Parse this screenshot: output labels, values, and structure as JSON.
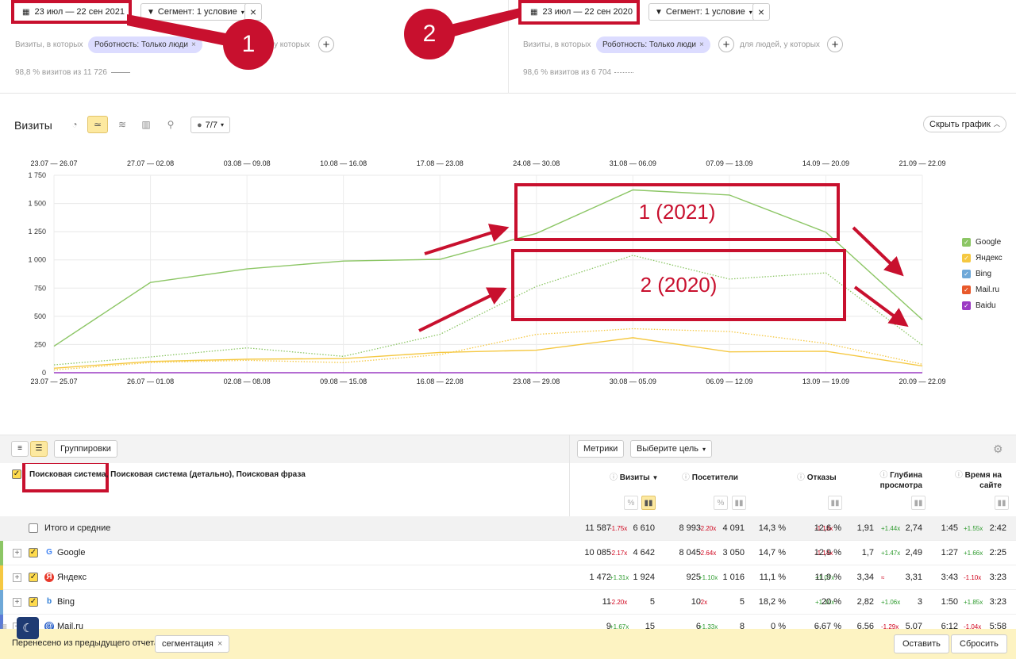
{
  "left_panel": {
    "date_range": "23 июл — 22 сен 2021",
    "segment_label": "Сегмент: 1 условие",
    "visits_where": "Визиты, в которых",
    "chip": "Роботность: Только люди",
    "people_where": "у которых",
    "stat": "98,8 % визитов из 11 726"
  },
  "right_panel": {
    "date_range": "23 июл — 22 сен 2020",
    "segment_label": "Сегмент: 1 условие",
    "visits_where": "Визиты, в которых",
    "chip": "Роботность: Только люди",
    "people_where": "для людей, у которых",
    "stat": "98,6 % визитов из 6 704"
  },
  "annotations": {
    "circle1": "1",
    "circle2": "2",
    "box_2021": "1 (2021)",
    "box_2020": "2 (2020)"
  },
  "chart_toolbar": {
    "title": "Визиты",
    "notes": "7/7",
    "hide_chart": "Скрыть график"
  },
  "chart_data": {
    "type": "line",
    "top_ticks": [
      "23.07 — 26.07",
      "27.07 — 02.08",
      "03.08 — 09.08",
      "10.08 — 16.08",
      "17.08 — 23.08",
      "24.08 — 30.08",
      "31.08 — 06.09",
      "07.09 — 13.09",
      "14.09 — 20.09",
      "21.09 — 22.09"
    ],
    "bottom_ticks": [
      "23.07 — 25.07",
      "26.07 — 01.08",
      "02.08 — 08.08",
      "09.08 — 15.08",
      "16.08 — 22.08",
      "23.08 — 29.08",
      "30.08 — 05.09",
      "06.09 — 12.09",
      "13.09 — 19.09",
      "20.09 — 22.09"
    ],
    "y_ticks": [
      "0",
      "250",
      "500",
      "750",
      "1 000",
      "1 250",
      "1 500",
      "1 750"
    ],
    "ylim": [
      0,
      1750
    ],
    "series": [
      {
        "name": "Google",
        "color": "#8cc665",
        "style": "solid",
        "values": [
          235,
          800,
          920,
          990,
          1005,
          1235,
          1620,
          1575,
          1245,
          470
        ]
      },
      {
        "name": "Google",
        "color": "#8cc665",
        "style": "dotted",
        "values": [
          70,
          140,
          220,
          145,
          340,
          765,
          1040,
          830,
          885,
          245
        ]
      },
      {
        "name": "Яндекс",
        "color": "#f5c842",
        "style": "solid",
        "values": [
          40,
          100,
          120,
          125,
          180,
          200,
          310,
          185,
          190,
          60
        ]
      },
      {
        "name": "Яндекс",
        "color": "#f5c842",
        "style": "dotted",
        "values": [
          25,
          90,
          110,
          90,
          160,
          340,
          390,
          365,
          260,
          75
        ]
      },
      {
        "name": "Baidu",
        "color": "#9c3cc4",
        "style": "solid",
        "values": [
          0,
          0,
          0,
          0,
          0,
          0,
          0,
          0,
          0,
          0
        ]
      }
    ]
  },
  "legend": [
    {
      "name": "Google",
      "color": "#8cc665"
    },
    {
      "name": "Яндекс",
      "color": "#f5c842"
    },
    {
      "name": "Bing",
      "color": "#6ea8d8"
    },
    {
      "name": "Mail.ru",
      "color": "#e8592b"
    },
    {
      "name": "Baidu",
      "color": "#9c3cc4"
    }
  ],
  "table_toolbar": {
    "groupings": "Группировки",
    "metrics": "Метрики",
    "goal": "Выберите цель"
  },
  "table_header": {
    "dims": "Поисковая система, Поисковая система (детально), Поисковая фраза",
    "visits": "Визиты",
    "visitors": "Посетители",
    "bounce": "Отказы",
    "depth": "Глубина просмотра",
    "time": "Время на сайте"
  },
  "rows": [
    {
      "name": "Итого и средние",
      "v1": "11 587",
      "vd": "-1.75x",
      "v2": "6 610",
      "p1": "8 993",
      "pd": "-2.20x",
      "p2": "4 091",
      "b1": "14,3 %",
      "bd": "-1.13x",
      "b2": "12,6 %",
      "g1": "1,91",
      "gd": "+1.44x",
      "g2": "2,74",
      "t1": "1:45",
      "td": "+1.55x",
      "t2": "2:42"
    },
    {
      "name": "Google",
      "v1": "10 085",
      "vd": "-2.17x",
      "v2": "4 642",
      "p1": "8 045",
      "pd": "-2.64x",
      "p2": "3 050",
      "b1": "14,7 %",
      "bd": "-1.14x",
      "b2": "12,9 %",
      "g1": "1,7",
      "gd": "+1.47x",
      "g2": "2,49",
      "t1": "1:27",
      "td": "+1.66x",
      "t2": "2:25"
    },
    {
      "name": "Яндекс",
      "v1": "1 472",
      "vd": "+1.31x",
      "v2": "1 924",
      "p1": "925",
      "pd": "+1.10x",
      "p2": "1 016",
      "b1": "11,1 %",
      "bd": "+1.07x",
      "b2": "11,9 %",
      "g1": "3,34",
      "gd": "≈",
      "g2": "3,31",
      "t1": "3:43",
      "td": "-1.10x",
      "t2": "3:23"
    },
    {
      "name": "Bing",
      "v1": "11",
      "vd": "-2.20x",
      "v2": "5",
      "p1": "10",
      "pd": "-2x",
      "p2": "5",
      "b1": "18,2 %",
      "bd": "+1.10x",
      "b2": "20 %",
      "g1": "2,82",
      "gd": "+1.06x",
      "g2": "3",
      "t1": "1:50",
      "td": "+1.85x",
      "t2": "3:23"
    },
    {
      "name": "Mail.ru",
      "v1": "9",
      "vd": "+1.67x",
      "v2": "15",
      "p1": "6",
      "pd": "+1.33x",
      "p2": "8",
      "b1": "0 %",
      "bd": "—",
      "b2": "6,67 %",
      "g1": "6,56",
      "gd": "-1.29x",
      "g2": "5,07",
      "t1": "6:12",
      "td": "-1.04x",
      "t2": "5:58"
    }
  ],
  "footer": {
    "moved_text": "Перенесено из предыдущего отчета:",
    "chip": "сегментация",
    "keep": "Оставить",
    "reset": "Сбросить"
  }
}
